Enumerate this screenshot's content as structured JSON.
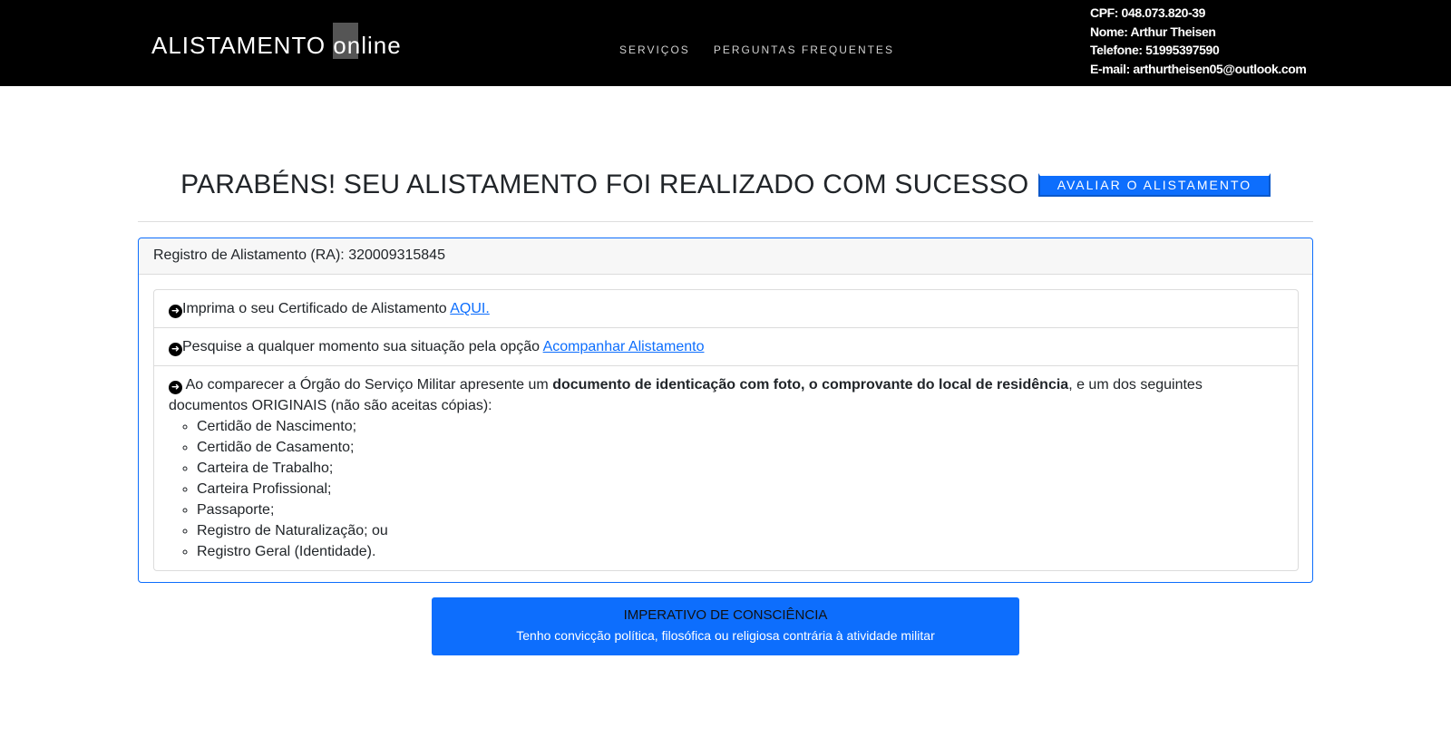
{
  "header": {
    "brand_main": "ALISTAMENTO ",
    "brand_highlight": "online",
    "nav": [
      "SERVIÇOS",
      "PERGUNTAS FREQUENTES"
    ],
    "user": {
      "cpf": "CPF: 048.073.820-39",
      "name": "Nome: Arthur Theisen",
      "phone": "Telefone: 51995397590",
      "email": "E-mail: arthurtheisen05@outlook.com"
    }
  },
  "main": {
    "headline": "PARABÉNS! SEU ALISTAMENTO FOI REALIZADO COM SUCESSO",
    "rate_button": "AVALIAR O ALISTAMENTO",
    "card_header": "Registro de Alistamento (RA): 320009315845",
    "item1_text": "Imprima o seu Certificado de Alistamento ",
    "item1_link": "AQUI.",
    "item2_text": "Pesquise a qualquer momento sua situação pela opção ",
    "item2_link": "Acompanhar Alistamento",
    "item3_pre": " Ao comparecer a Órgão do Serviço Militar apresente um ",
    "item3_bold": "documento de identicação com foto, o comprovante do local de residência",
    "item3_post": ", e um dos seguintes documentos ORIGINAIS (não são aceitas cópias):",
    "documents": [
      "Certidão de Nascimento;",
      "Certidão de Casamento;",
      "Carteira de Trabalho;",
      "Carteira Profissional;",
      "Passaporte;",
      "Registro de Naturalização; ou",
      "Registro Geral (Identidade)."
    ]
  },
  "cta": {
    "title": "IMPERATIVO DE CONSCIÊNCIA",
    "subtitle": "Tenho convicção política, filosófica ou religiosa contrária à atividade militar"
  },
  "colors": {
    "accent": "#0d6efd",
    "header_bg": "#000000"
  }
}
